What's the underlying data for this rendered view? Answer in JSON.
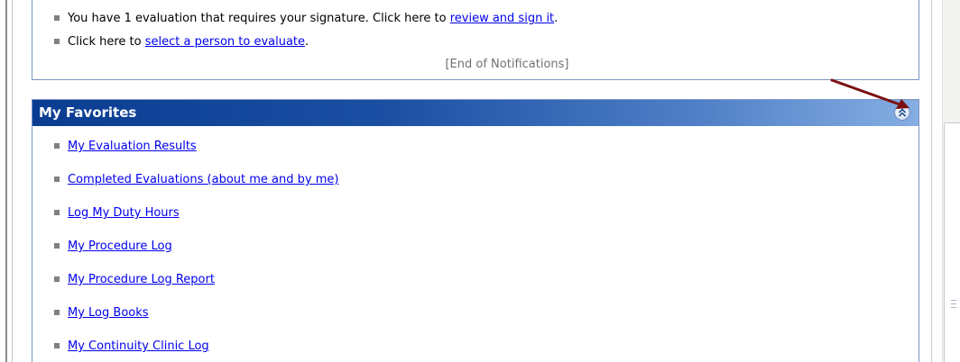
{
  "notifications": {
    "items": [
      {
        "text": "You have 1 evaluation that requires your signature. Click here to ",
        "link": "review and sign it",
        "suffix": "."
      },
      {
        "text": "Click here to ",
        "link": "select a person to evaluate",
        "suffix": "."
      }
    ],
    "end_text": "[End of Notifications]"
  },
  "favorites": {
    "title": "My Favorites",
    "collapse_icon": "double-chevron-up-icon",
    "items": [
      "My Evaluation Results",
      "Completed Evaluations (about me and by me)",
      "Log My Duty Hours",
      "My Procedure Log",
      "My Procedure Log Report",
      "My Log Books",
      "My Continuity Clinic Log"
    ]
  },
  "colors": {
    "header_dark": "#0a3d91",
    "header_light": "#86aee3",
    "link": "#0000ee",
    "annotation_arrow": "#7b1010",
    "panel_border": "#7a96c4"
  },
  "icons": {
    "bullet": "square-bullet-icon",
    "annotation": "red-arrow-icon"
  }
}
